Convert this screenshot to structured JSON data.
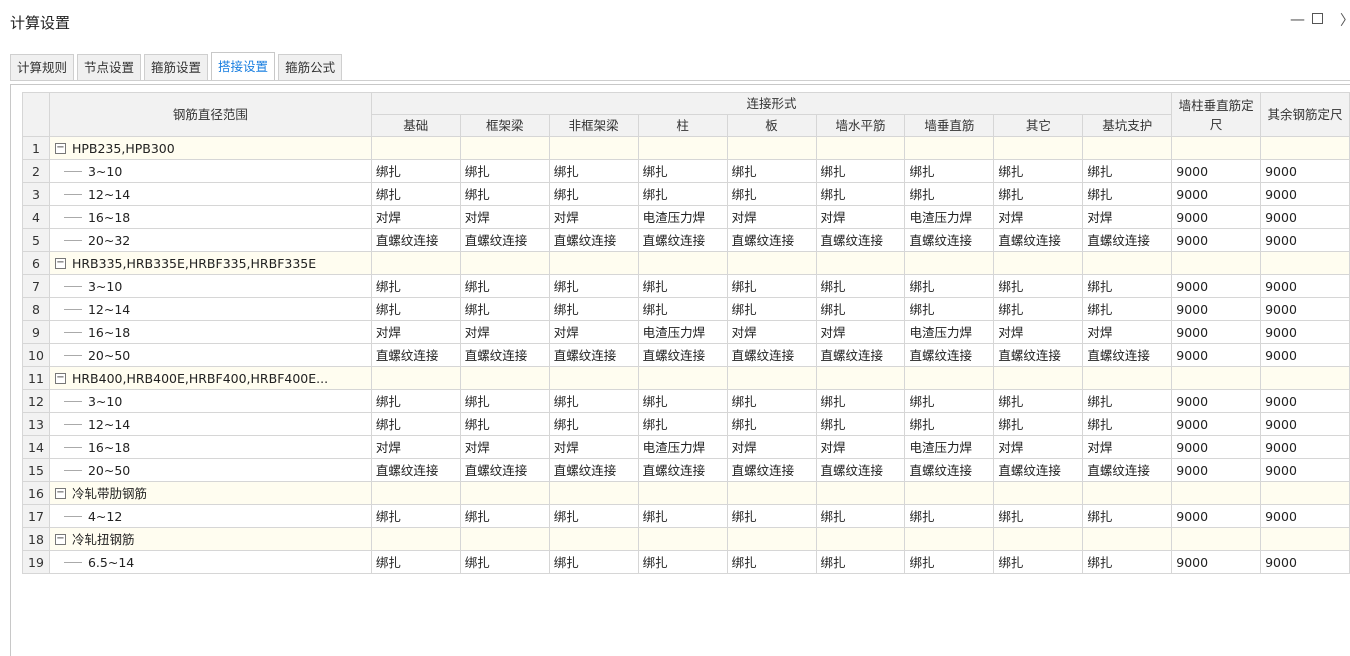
{
  "window": {
    "title": "计算设置",
    "min": "—",
    "max": "",
    "close": "〉"
  },
  "tabs": [
    {
      "label": "计算规则",
      "active": false
    },
    {
      "label": "节点设置",
      "active": false
    },
    {
      "label": "箍筋设置",
      "active": false
    },
    {
      "label": "搭接设置",
      "active": true
    },
    {
      "label": "箍筋公式",
      "active": false
    }
  ],
  "table": {
    "header": {
      "range": "钢筋直径范围",
      "connection_group": "连接形式",
      "connection_cols": [
        "基础",
        "框架梁",
        "非框架梁",
        "柱",
        "板",
        "墙水平筋",
        "墙垂直筋",
        "其它",
        "基坑支护"
      ],
      "wall_col_length": "墙柱垂直筋定尺",
      "other_length": "其余钢筋定尺"
    },
    "rows": [
      {
        "n": "1",
        "type": "group",
        "label": "HPB235,HPB300"
      },
      {
        "n": "2",
        "type": "item",
        "label": "3~10",
        "cells": [
          "绑扎",
          "绑扎",
          "绑扎",
          "绑扎",
          "绑扎",
          "绑扎",
          "绑扎",
          "绑扎",
          "绑扎"
        ],
        "len1": "9000",
        "len2": "9000"
      },
      {
        "n": "3",
        "type": "item",
        "label": "12~14",
        "cells": [
          "绑扎",
          "绑扎",
          "绑扎",
          "绑扎",
          "绑扎",
          "绑扎",
          "绑扎",
          "绑扎",
          "绑扎"
        ],
        "len1": "9000",
        "len2": "9000"
      },
      {
        "n": "4",
        "type": "item",
        "label": "16~18",
        "cells": [
          "对焊",
          "对焊",
          "对焊",
          "电渣压力焊",
          "对焊",
          "对焊",
          "电渣压力焊",
          "对焊",
          "对焊"
        ],
        "len1": "9000",
        "len2": "9000"
      },
      {
        "n": "5",
        "type": "item",
        "label": "20~32",
        "cells": [
          "直螺纹连接",
          "直螺纹连接",
          "直螺纹连接",
          "直螺纹连接",
          "直螺纹连接",
          "直螺纹连接",
          "直螺纹连接",
          "直螺纹连接",
          "直螺纹连接"
        ],
        "len1": "9000",
        "len2": "9000"
      },
      {
        "n": "6",
        "type": "group",
        "label": "HRB335,HRB335E,HRBF335,HRBF335E"
      },
      {
        "n": "7",
        "type": "item",
        "label": "3~10",
        "cells": [
          "绑扎",
          "绑扎",
          "绑扎",
          "绑扎",
          "绑扎",
          "绑扎",
          "绑扎",
          "绑扎",
          "绑扎"
        ],
        "len1": "9000",
        "len2": "9000"
      },
      {
        "n": "8",
        "type": "item",
        "label": "12~14",
        "cells": [
          "绑扎",
          "绑扎",
          "绑扎",
          "绑扎",
          "绑扎",
          "绑扎",
          "绑扎",
          "绑扎",
          "绑扎"
        ],
        "len1": "9000",
        "len2": "9000"
      },
      {
        "n": "9",
        "type": "item",
        "label": "16~18",
        "cells": [
          "对焊",
          "对焊",
          "对焊",
          "电渣压力焊",
          "对焊",
          "对焊",
          "电渣压力焊",
          "对焊",
          "对焊"
        ],
        "len1": "9000",
        "len2": "9000"
      },
      {
        "n": "10",
        "type": "item",
        "label": "20~50",
        "cells": [
          "直螺纹连接",
          "直螺纹连接",
          "直螺纹连接",
          "直螺纹连接",
          "直螺纹连接",
          "直螺纹连接",
          "直螺纹连接",
          "直螺纹连接",
          "直螺纹连接"
        ],
        "len1": "9000",
        "len2": "9000"
      },
      {
        "n": "11",
        "type": "group",
        "label": "HRB400,HRB400E,HRBF400,HRBF400E..."
      },
      {
        "n": "12",
        "type": "item",
        "label": "3~10",
        "cells": [
          "绑扎",
          "绑扎",
          "绑扎",
          "绑扎",
          "绑扎",
          "绑扎",
          "绑扎",
          "绑扎",
          "绑扎"
        ],
        "len1": "9000",
        "len2": "9000"
      },
      {
        "n": "13",
        "type": "item",
        "label": "12~14",
        "cells": [
          "绑扎",
          "绑扎",
          "绑扎",
          "绑扎",
          "绑扎",
          "绑扎",
          "绑扎",
          "绑扎",
          "绑扎"
        ],
        "len1": "9000",
        "len2": "9000"
      },
      {
        "n": "14",
        "type": "item",
        "label": "16~18",
        "cells": [
          "对焊",
          "对焊",
          "对焊",
          "电渣压力焊",
          "对焊",
          "对焊",
          "电渣压力焊",
          "对焊",
          "对焊"
        ],
        "len1": "9000",
        "len2": "9000"
      },
      {
        "n": "15",
        "type": "item",
        "label": "20~50",
        "cells": [
          "直螺纹连接",
          "直螺纹连接",
          "直螺纹连接",
          "直螺纹连接",
          "直螺纹连接",
          "直螺纹连接",
          "直螺纹连接",
          "直螺纹连接",
          "直螺纹连接"
        ],
        "len1": "9000",
        "len2": "9000"
      },
      {
        "n": "16",
        "type": "group",
        "label": "冷轧带肋钢筋"
      },
      {
        "n": "17",
        "type": "item",
        "label": "4~12",
        "cells": [
          "绑扎",
          "绑扎",
          "绑扎",
          "绑扎",
          "绑扎",
          "绑扎",
          "绑扎",
          "绑扎",
          "绑扎"
        ],
        "len1": "9000",
        "len2": "9000"
      },
      {
        "n": "18",
        "type": "group",
        "label": "冷轧扭钢筋"
      },
      {
        "n": "19",
        "type": "item",
        "label": "6.5~14",
        "cells": [
          "绑扎",
          "绑扎",
          "绑扎",
          "绑扎",
          "绑扎",
          "绑扎",
          "绑扎",
          "绑扎",
          "绑扎"
        ],
        "len1": "9000",
        "len2": "9000"
      }
    ],
    "expand_symbol": "−"
  }
}
